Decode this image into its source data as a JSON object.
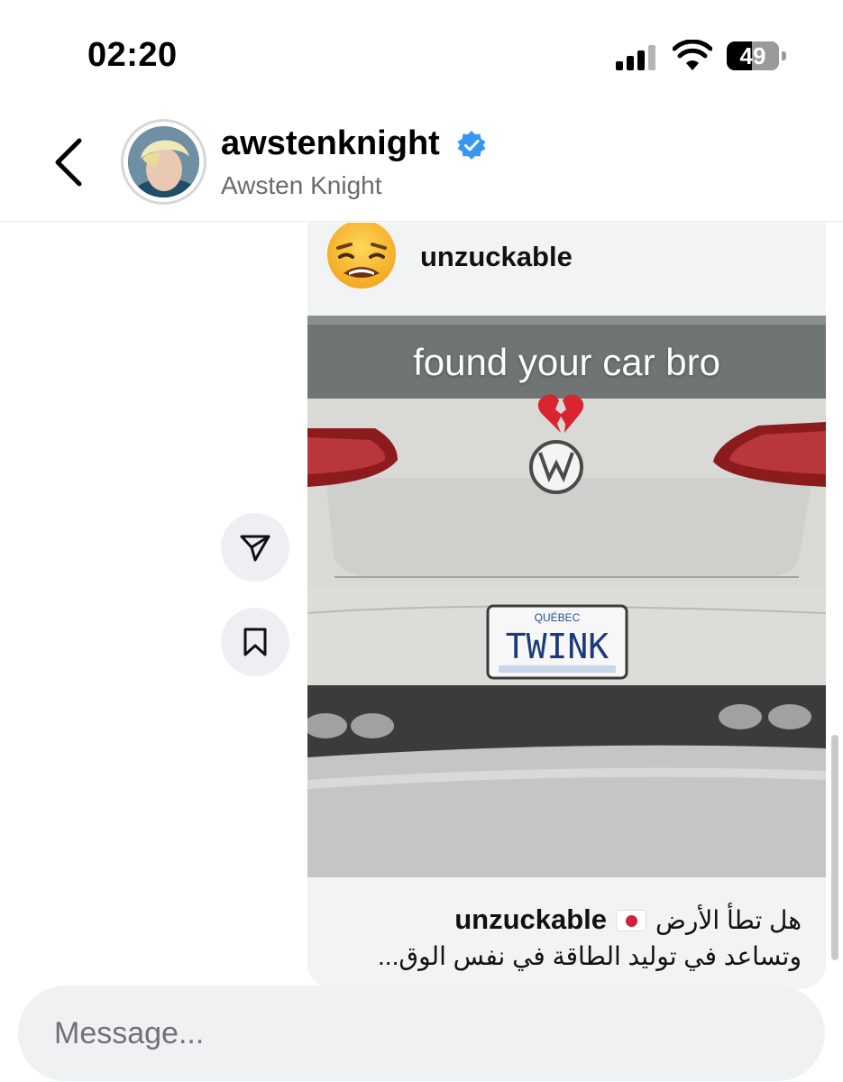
{
  "status_bar": {
    "time": "02:20",
    "battery_level": "49",
    "battery_fraction": 0.49,
    "signal_icon": "cellular-signal-icon",
    "wifi_icon": "wifi-icon"
  },
  "header": {
    "username": "awstenknight",
    "full_name": "Awsten Knight",
    "verified": true,
    "back_icon": "chevron-left-icon",
    "accent_color": "#3897f0"
  },
  "shared_post": {
    "author": "unzuckable",
    "author_avatar": "weary-face-emoji",
    "image_overlay_text": "found your car bro",
    "image_overlay_emoji": "broken-heart-emoji",
    "plate_text": "TWINK",
    "plate_region": "QUÉBEC",
    "caption_user": "unzuckable",
    "caption_line1": "هل تطأ الأرض",
    "caption_flag": "japan-flag",
    "caption_line2": "وتساعد في توليد الطاقة في نفس الوق..."
  },
  "side_actions": {
    "share_icon": "send-icon",
    "save_icon": "bookmark-icon"
  },
  "composer": {
    "placeholder": "Message..."
  }
}
